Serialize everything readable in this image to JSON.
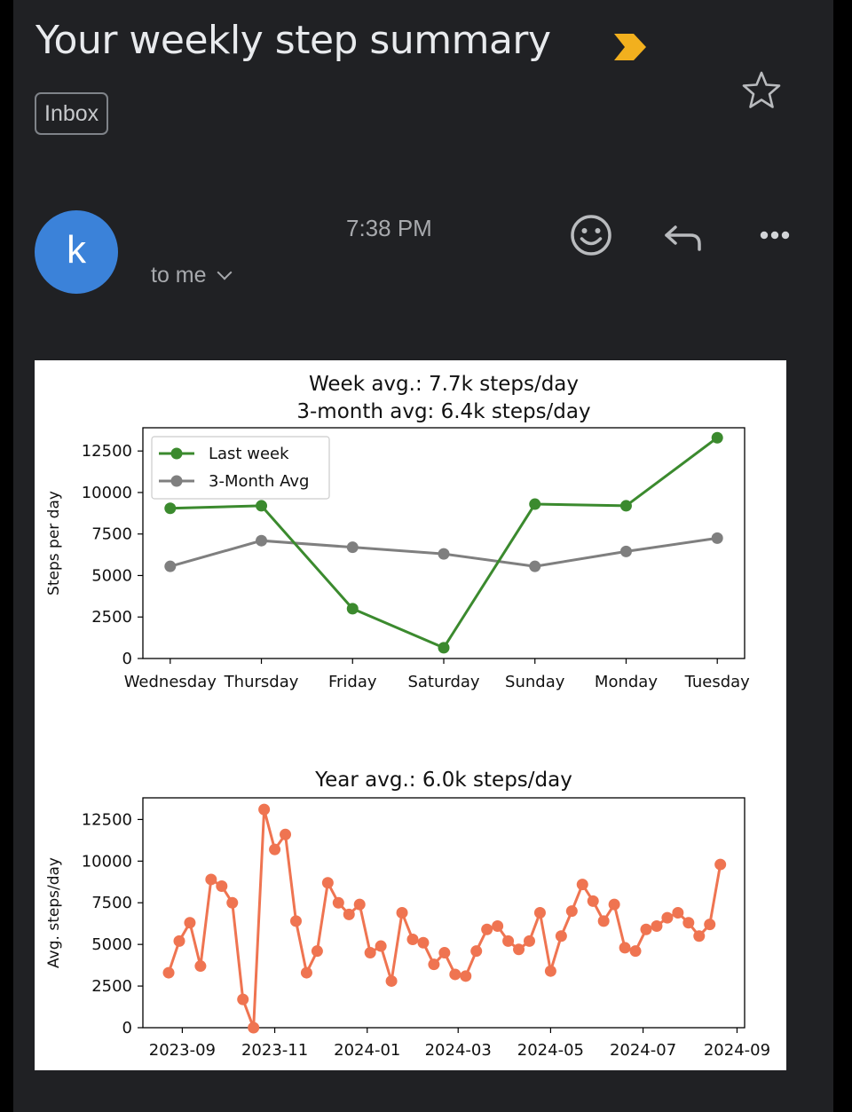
{
  "email": {
    "subject": "Your weekly step summary",
    "label": "Inbox",
    "sender_initial": "k",
    "time": "7:38 PM",
    "recipient": "to me"
  },
  "colors": {
    "background": "#202124",
    "avatar": "#3b82d9",
    "important_marker": "#f2b01e",
    "last_week": "#3b8a2e",
    "three_month": "#7f7f7f",
    "year": "#ef7451"
  },
  "icons": [
    "importance-marker-icon",
    "star-icon",
    "emoji-reaction-icon",
    "reply-icon",
    "more-options-icon",
    "chevron-down-icon"
  ],
  "chart_data": [
    {
      "type": "line",
      "title": "Week avg.: 7.7k steps/day\n3-month avg: 6.4k steps/day",
      "title_lines": [
        "Week avg.: 7.7k steps/day",
        "3-month avg: 6.4k steps/day"
      ],
      "xlabel": "",
      "ylabel": "Steps per day",
      "categories": [
        "Wednesday",
        "Thursday",
        "Friday",
        "Saturday",
        "Sunday",
        "Monday",
        "Tuesday"
      ],
      "series": [
        {
          "name": "Last week",
          "values": [
            9050,
            9200,
            3000,
            650,
            9300,
            9200,
            13300
          ]
        },
        {
          "name": "3-Month Avg",
          "values": [
            5550,
            7100,
            6700,
            6300,
            5550,
            6450,
            7250
          ]
        }
      ],
      "ylim": [
        0,
        13900
      ],
      "yticks": [
        0,
        2500,
        5000,
        7500,
        10000,
        12500
      ],
      "grid": false,
      "legend_position": "top-left"
    },
    {
      "type": "line",
      "title": "Year avg.: 6.0k steps/day",
      "xlabel": "",
      "ylabel": "Avg. steps/day",
      "x": [
        "2023-08-23",
        "2023-08-30",
        "2023-09-06",
        "2023-09-13",
        "2023-09-20",
        "2023-09-27",
        "2023-10-04",
        "2023-10-11",
        "2023-10-18",
        "2023-10-25",
        "2023-11-01",
        "2023-11-08",
        "2023-11-15",
        "2023-11-22",
        "2023-11-29",
        "2023-12-06",
        "2023-12-13",
        "2023-12-20",
        "2023-12-27",
        "2024-01-03",
        "2024-01-10",
        "2024-01-17",
        "2024-01-24",
        "2024-01-31",
        "2024-02-07",
        "2024-02-14",
        "2024-02-21",
        "2024-02-28",
        "2024-03-06",
        "2024-03-13",
        "2024-03-20",
        "2024-03-27",
        "2024-04-03",
        "2024-04-10",
        "2024-04-17",
        "2024-04-24",
        "2024-05-01",
        "2024-05-08",
        "2024-05-15",
        "2024-05-22",
        "2024-05-29",
        "2024-06-05",
        "2024-06-12",
        "2024-06-19",
        "2024-06-26",
        "2024-07-03",
        "2024-07-10",
        "2024-07-17",
        "2024-07-24",
        "2024-07-31",
        "2024-08-07",
        "2024-08-14",
        "2024-08-21"
      ],
      "y": [
        3300,
        5200,
        6300,
        3700,
        8900,
        8500,
        7500,
        1700,
        0,
        13100,
        10700,
        11600,
        6400,
        3300,
        4600,
        8700,
        7500,
        6800,
        7400,
        4500,
        4900,
        2800,
        6900,
        5300,
        5100,
        3800,
        4500,
        3200,
        3100,
        4600,
        5900,
        6100,
        5200,
        4700,
        5200,
        6900,
        3400,
        5500,
        7000,
        8600,
        7600,
        6400,
        7400,
        4800,
        4600,
        5900,
        6100,
        6600,
        6900,
        6300,
        5500,
        6200,
        9800
      ],
      "ylim": [
        0,
        13800
      ],
      "yticks": [
        0,
        2500,
        5000,
        7500,
        10000,
        12500
      ],
      "xticks": [
        "2023-09",
        "2023-11",
        "2024-01",
        "2024-03",
        "2024-05",
        "2024-07",
        "2024-09"
      ],
      "grid": false
    }
  ]
}
